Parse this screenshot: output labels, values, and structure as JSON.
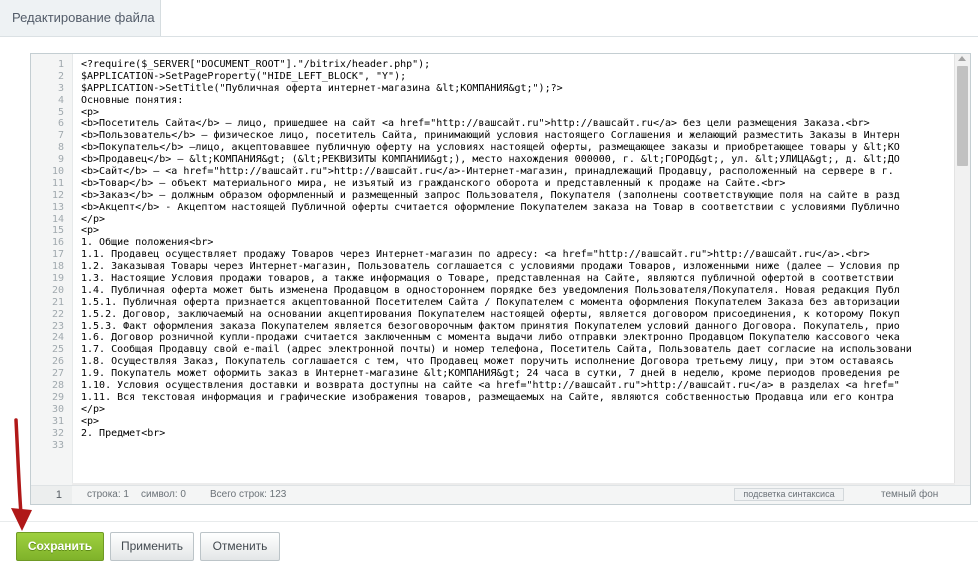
{
  "tab": {
    "title": "Редактирование файла"
  },
  "editor": {
    "line_numbers": [
      "1",
      "2",
      "3",
      "4",
      "5",
      "6",
      "7",
      "8",
      "9",
      "10",
      "11",
      "12",
      "13",
      "14",
      "15",
      "16",
      "17",
      "18",
      "19",
      "20",
      "21",
      "22",
      "23",
      "24",
      "25",
      "26",
      "27",
      "28",
      "29",
      "30",
      "31",
      "32",
      "33"
    ],
    "lines": [
      "<?require($_SERVER[\"DOCUMENT_ROOT\"].\"/bitrix/header.php\");",
      "$APPLICATION->SetPageProperty(\"HIDE_LEFT_BLOCK\", \"Y\");",
      "$APPLICATION->SetTitle(\"Публичная оферта интернет-магазина &lt;КОМПАНИЯ&gt;\");?>",
      "Основные понятия:",
      "<p>",
      "<b>Посетитель Сайта</b> — лицо, пришедшее на сайт <a href=\"http://вашсайт.ru\">http://вашсайт.ru</a> без цели размещения Заказа.<br>",
      "<b>Пользователь</b> — физическое лицо, посетитель Сайта, принимающий условия настоящего Соглашения и желающий разместить Заказы в Интерн",
      "<b>Покупатель</b> —лицо, акцептовавшее публичную оферту на условиях настоящей оферты, размещающее заказы и приобретающее товары у &lt;КО",
      "<b>Продавец</b> — &lt;КОМПАНИЯ&gt; (&lt;РЕКВИЗИТЫ КОМПАНИИ&gt;), место нахождения 000000, г. &lt;ГОРОД&gt;, ул. &lt;УЛИЦА&gt;, д. &lt;ДО",
      "<b>Сайт</b> — <a href=\"http://вашсайт.ru\">http://вашсайт.ru</a>-Интернет-магазин, принадлежащий Продавцу, расположенный на сервере в г.",
      "<b>Товар</b> — объект материального мира, не изъятый из гражданского оборота и представленный к продаже на Сайте.<br>",
      "<b>Заказ</b> — должным образом оформленный и размещенный запрос Пользователя, Покупателя (заполнены соответствующие поля на сайте в разд",
      "<b>Акцепт</b> - Акцептом настоящей Публичной оферты считается оформление Покупателем заказа на Товар в соответствии с условиями Публично",
      "</p>",
      "<p>",
      "1. Общие положения<br>",
      "1.1. Продавец осуществляет продажу Товаров через Интернет-магазин по адресу: <a href=\"http://вашсайт.ru\">http://вашсайт.ru</a>.<br>",
      "1.2. Заказывая Товары через Интернет-магазин, Пользователь соглашается с условиями продажи Товаров, изложенными ниже (далее — Условия пр",
      "1.3. Настоящие Условия продажи товаров, а также информация о Товаре, представленная на Сайте, являются публичной офертой в соответствии",
      "1.4. Публичная оферта может быть изменена Продавцом в одностороннем порядке без уведомления Пользователя/Покупателя. Новая редакция Публ",
      "1.5.1. Публичная оферта признается акцептованной Посетителем Сайта / Покупателем с момента оформления Покупателем Заказа без авторизации",
      "1.5.2. Договор, заключаемый на основании акцептирования Покупателем настоящей оферты, является договором присоединения, к которому Покуп",
      "1.5.3. Факт оформления заказа Покупателем является безоговорочным фактом принятия Покупателем условий данного Договора. Покупатель, прио",
      "1.6. Договор розничной купли-продажи считается заключенным с момента выдачи либо отправки электронно Продавцом Покупателю кассового чека",
      "1.7. Сообщая Продавцу свой e-mail (адрес электронной почты) и номер телефона, Посетитель Сайта, Пользователь дает согласие на использовани",
      "1.8. Осуществляя Заказ, Покупатель соглашается с тем, что Продавец может поручить исполнение Договора третьему лицу, при этом оставаясь",
      "1.9. Покупатель может оформить заказ в Интернет-магазине &lt;КОМПАНИЯ&gt; 24 часа в сутки, 7 дней в неделю, кроме периодов проведения ре",
      "1.10. Условия осуществления доставки и возврата доступны на сайте <a href=\"http://вашсайт.ru\">http://вашсайт.ru</a> в разделах <a href=\"",
      "1.11. Вся текстовая информация и графические изображения товаров, размещаемых на Сайте, являются собственностью Продавца или его контра",
      "</p>",
      "<p>",
      "2. Предмет<br>",
      ""
    ]
  },
  "status": {
    "current_line": "1",
    "position": "строка: 1",
    "symbol": "символ: 0",
    "total": "Всего строк: 123",
    "syntax_button": "подсветка синтаксиса",
    "theme": "темный фон"
  },
  "buttons": {
    "save": "Сохранить",
    "apply": "Применить",
    "cancel": "Отменить"
  },
  "colors": {
    "save_button": "#8bc034",
    "arrow": "#b01818"
  }
}
